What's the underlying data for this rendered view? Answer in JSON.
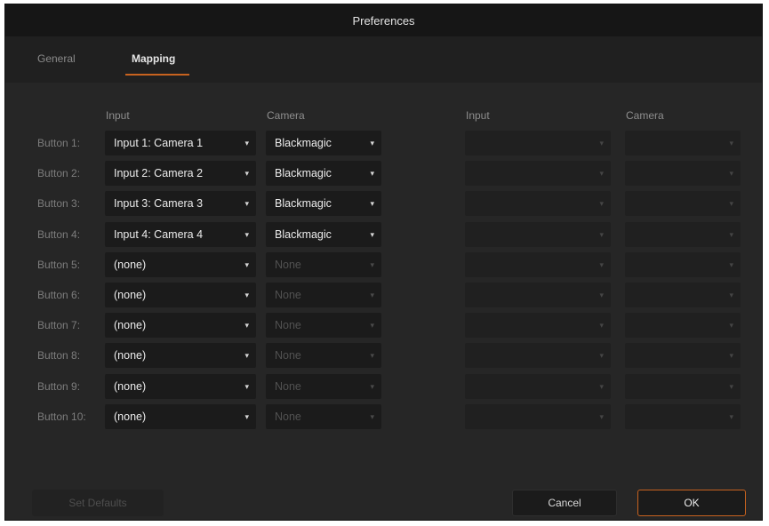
{
  "window": {
    "title": "Preferences"
  },
  "tabs": [
    {
      "label": "General",
      "active": false
    },
    {
      "label": "Mapping",
      "active": true
    }
  ],
  "columns": {
    "left_input": "Input",
    "left_camera": "Camera",
    "right_input": "Input",
    "right_camera": "Camera"
  },
  "rows": [
    {
      "label": "Button 1:",
      "input": "Input 1: Camera 1",
      "camera": "Blackmagic",
      "camera_enabled": true
    },
    {
      "label": "Button 2:",
      "input": "Input 2: Camera 2",
      "camera": "Blackmagic",
      "camera_enabled": true
    },
    {
      "label": "Button 3:",
      "input": "Input 3: Camera 3",
      "camera": "Blackmagic",
      "camera_enabled": true
    },
    {
      "label": "Button 4:",
      "input": "Input 4: Camera 4",
      "camera": "Blackmagic",
      "camera_enabled": true
    },
    {
      "label": "Button 5:",
      "input": "(none)",
      "camera": "None",
      "camera_enabled": false
    },
    {
      "label": "Button 6:",
      "input": "(none)",
      "camera": "None",
      "camera_enabled": false
    },
    {
      "label": "Button 7:",
      "input": "(none)",
      "camera": "None",
      "camera_enabled": false
    },
    {
      "label": "Button 8:",
      "input": "(none)",
      "camera": "None",
      "camera_enabled": false
    },
    {
      "label": "Button 9:",
      "input": "(none)",
      "camera": "None",
      "camera_enabled": false
    },
    {
      "label": "Button 10:",
      "input": "(none)",
      "camera": "None",
      "camera_enabled": false
    }
  ],
  "buttons": {
    "set_defaults": "Set Defaults",
    "cancel": "Cancel",
    "ok": "OK"
  },
  "icons": {
    "dropdown": "chevron-down-icon"
  },
  "colors": {
    "accent": "#c7621f",
    "background": "#262626",
    "titlebar": "#161616",
    "control": "#1b1b1b"
  }
}
